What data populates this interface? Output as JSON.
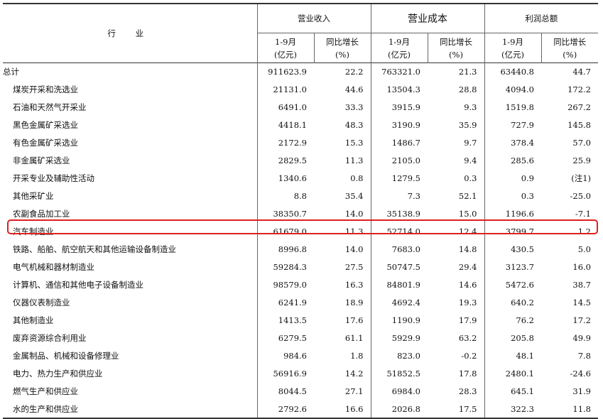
{
  "header": {
    "industry": "行 业",
    "groups": [
      "营业收入",
      "营业成本",
      "利润总额"
    ],
    "sub_period": [
      "1-9月",
      "(亿元)"
    ],
    "sub_growth": [
      "同比增长",
      "(%)"
    ]
  },
  "rows": [
    {
      "name": "总计",
      "indent": false,
      "v": [
        "911623.9",
        "22.2",
        "763321.0",
        "21.3",
        "63440.8",
        "44.7"
      ]
    },
    {
      "name": "煤炭开采和洗选业",
      "indent": true,
      "v": [
        "21131.0",
        "44.6",
        "13504.3",
        "28.8",
        "4094.0",
        "172.2"
      ]
    },
    {
      "name": "石油和天然气开采业",
      "indent": true,
      "v": [
        "6491.0",
        "33.3",
        "3915.9",
        "9.3",
        "1519.8",
        "267.2"
      ]
    },
    {
      "name": "黑色金属矿采选业",
      "indent": true,
      "v": [
        "4418.1",
        "48.3",
        "3190.9",
        "35.9",
        "727.9",
        "145.8"
      ]
    },
    {
      "name": "有色金属矿采选业",
      "indent": true,
      "v": [
        "2172.9",
        "15.3",
        "1486.7",
        "9.7",
        "378.4",
        "57.0"
      ]
    },
    {
      "name": "非金属矿采选业",
      "indent": true,
      "v": [
        "2829.5",
        "11.3",
        "2105.0",
        "9.4",
        "285.6",
        "25.9"
      ]
    },
    {
      "name": "开采专业及辅助性活动",
      "indent": true,
      "v": [
        "1340.6",
        "0.8",
        "1279.5",
        "0.3",
        "0.9",
        "(注1)"
      ]
    },
    {
      "name": "其他采矿业",
      "indent": true,
      "v": [
        "8.8",
        "35.4",
        "7.3",
        "52.1",
        "0.3",
        "-25.0"
      ]
    },
    {
      "name": "农副食品加工业",
      "indent": true,
      "v": [
        "38350.7",
        "14.0",
        "35138.9",
        "15.0",
        "1196.6",
        "-7.1"
      ]
    },
    {
      "name": "汽车制造业",
      "indent": true,
      "v": [
        "61679.0",
        "11.3",
        "52714.0",
        "12.4",
        "3799.7",
        "1.2"
      ]
    },
    {
      "name": "铁路、船舶、航空航天和其他运输设备制造业",
      "indent": true,
      "v": [
        "8996.8",
        "14.0",
        "7683.0",
        "14.8",
        "430.5",
        "5.0"
      ]
    },
    {
      "name": "电气机械和器材制造业",
      "indent": true,
      "v": [
        "59284.3",
        "27.5",
        "50747.5",
        "29.4",
        "3123.7",
        "16.0"
      ]
    },
    {
      "name": "计算机、通信和其他电子设备制造业",
      "indent": true,
      "v": [
        "98579.0",
        "16.3",
        "84801.9",
        "14.6",
        "5472.6",
        "38.7"
      ]
    },
    {
      "name": "仪器仪表制造业",
      "indent": true,
      "v": [
        "6241.9",
        "18.9",
        "4692.4",
        "19.3",
        "640.2",
        "14.5"
      ]
    },
    {
      "name": "其他制造业",
      "indent": true,
      "v": [
        "1413.5",
        "17.6",
        "1190.9",
        "17.9",
        "76.2",
        "17.2"
      ]
    },
    {
      "name": "废弃资源综合利用业",
      "indent": true,
      "v": [
        "6279.5",
        "61.1",
        "5929.9",
        "63.2",
        "205.8",
        "49.9"
      ]
    },
    {
      "name": "金属制品、机械和设备修理业",
      "indent": true,
      "v": [
        "984.6",
        "1.8",
        "823.0",
        "-0.2",
        "48.1",
        "7.8"
      ]
    },
    {
      "name": "电力、热力生产和供应业",
      "indent": true,
      "v": [
        "56916.9",
        "14.2",
        "51852.5",
        "17.8",
        "2480.1",
        "-24.6"
      ]
    },
    {
      "name": "燃气生产和供应业",
      "indent": true,
      "v": [
        "8044.5",
        "27.1",
        "6984.0",
        "28.3",
        "645.1",
        "31.9"
      ]
    },
    {
      "name": "水的生产和供应业",
      "indent": true,
      "v": [
        "2792.6",
        "16.6",
        "2026.8",
        "17.5",
        "322.3",
        "11.8"
      ]
    }
  ],
  "highlight_row": "汽车制造业",
  "colors": {
    "highlight": "#e02020",
    "rule": "#333333"
  }
}
